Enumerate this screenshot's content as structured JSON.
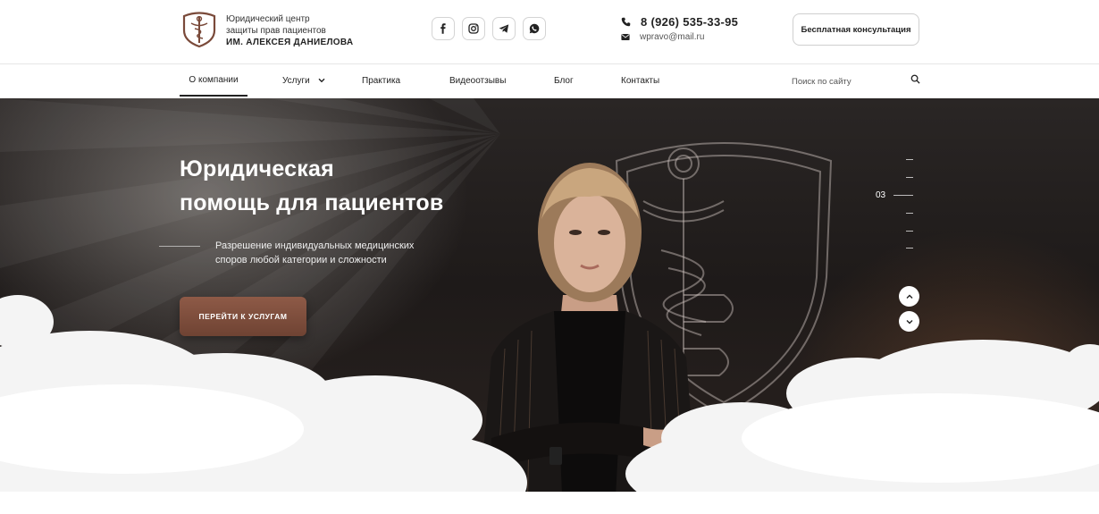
{
  "brand": {
    "line1": "Юридический центр",
    "line2": "защиты прав пациентов",
    "line3": "ИМ. АЛЕКСЕЯ ДАНИЕЛОВА",
    "logo_icon": "shield-caduceus-icon",
    "accent": "#7a4a3a"
  },
  "socials": [
    {
      "name": "facebook",
      "icon": "facebook-icon"
    },
    {
      "name": "instagram",
      "icon": "instagram-icon"
    },
    {
      "name": "telegram",
      "icon": "telegram-icon"
    },
    {
      "name": "whatsapp",
      "icon": "whatsapp-icon"
    }
  ],
  "contacts": {
    "phone": "8 (926) 535-33-95",
    "email": "wpravo@mail.ru"
  },
  "header": {
    "consult_label": "Бесплатная консультация"
  },
  "nav": {
    "items": [
      {
        "label": "О компании",
        "active": true
      },
      {
        "label": "Услуги",
        "has_dropdown": true
      },
      {
        "label": "Практика"
      },
      {
        "label": "Видеоотзывы"
      },
      {
        "label": "Блог"
      },
      {
        "label": "Контакты"
      }
    ],
    "search_placeholder": "Поиск по сайту"
  },
  "hero": {
    "title_line1": "Юридическая",
    "title_line2": "помощь для пациентов",
    "subtitle_line1": "Разрешение индивидуальных медицинских",
    "subtitle_line2": "споров любой категории и сложности",
    "cta_label": "ПЕРЕЙТИ К УСЛУГАМ",
    "slide_number": "03",
    "cta_color": "#7d4d3c"
  }
}
